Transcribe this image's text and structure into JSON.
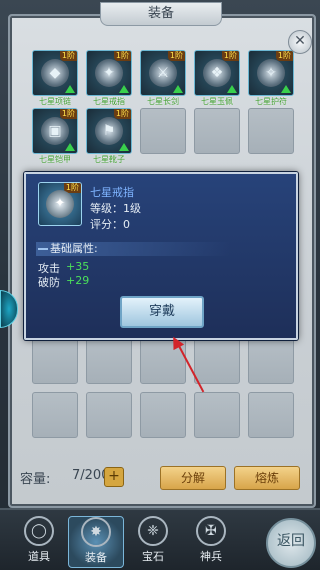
{
  "title": "装备",
  "close_symbol": "✕",
  "equipment": [
    {
      "label": "七星项链",
      "level": "1阶",
      "gem": "◆"
    },
    {
      "label": "七星戒指",
      "level": "1阶",
      "gem": "✦"
    },
    {
      "label": "七星长剑",
      "level": "1阶",
      "gem": "⚔"
    },
    {
      "label": "七星玉佩",
      "level": "1阶",
      "gem": "❖"
    },
    {
      "label": "七星护符",
      "level": "1阶",
      "gem": "✧"
    },
    {
      "label": "七星铠甲",
      "level": "1阶",
      "gem": "▣"
    },
    {
      "label": "七星靴子",
      "level": "1阶",
      "gem": "⚑"
    }
  ],
  "capacity": {
    "label": "容量:",
    "value": "7/200",
    "plus": "+"
  },
  "buttons": {
    "decompose": "分解",
    "smelt": "熔炼"
  },
  "tabs": [
    {
      "label": "道具",
      "icon": "◯"
    },
    {
      "label": "装备",
      "icon": "✸"
    },
    {
      "label": "宝石",
      "icon": "❈"
    },
    {
      "label": "神兵",
      "icon": "✠"
    }
  ],
  "return_label": "返回",
  "tooltip": {
    "name": "七星戒指",
    "level_badge": "1阶",
    "level_text": "等级：1级",
    "score_text": "评分：0",
    "section_title": "基础属性:",
    "stats": [
      {
        "name": "攻击",
        "value": "+35"
      },
      {
        "name": "破防",
        "value": "+29"
      }
    ],
    "wear_button": "穿戴"
  },
  "colors": {
    "item_label": "#3f9e2f",
    "stat_value": "#4be05a",
    "tooltip_name": "#7fb4ff"
  }
}
